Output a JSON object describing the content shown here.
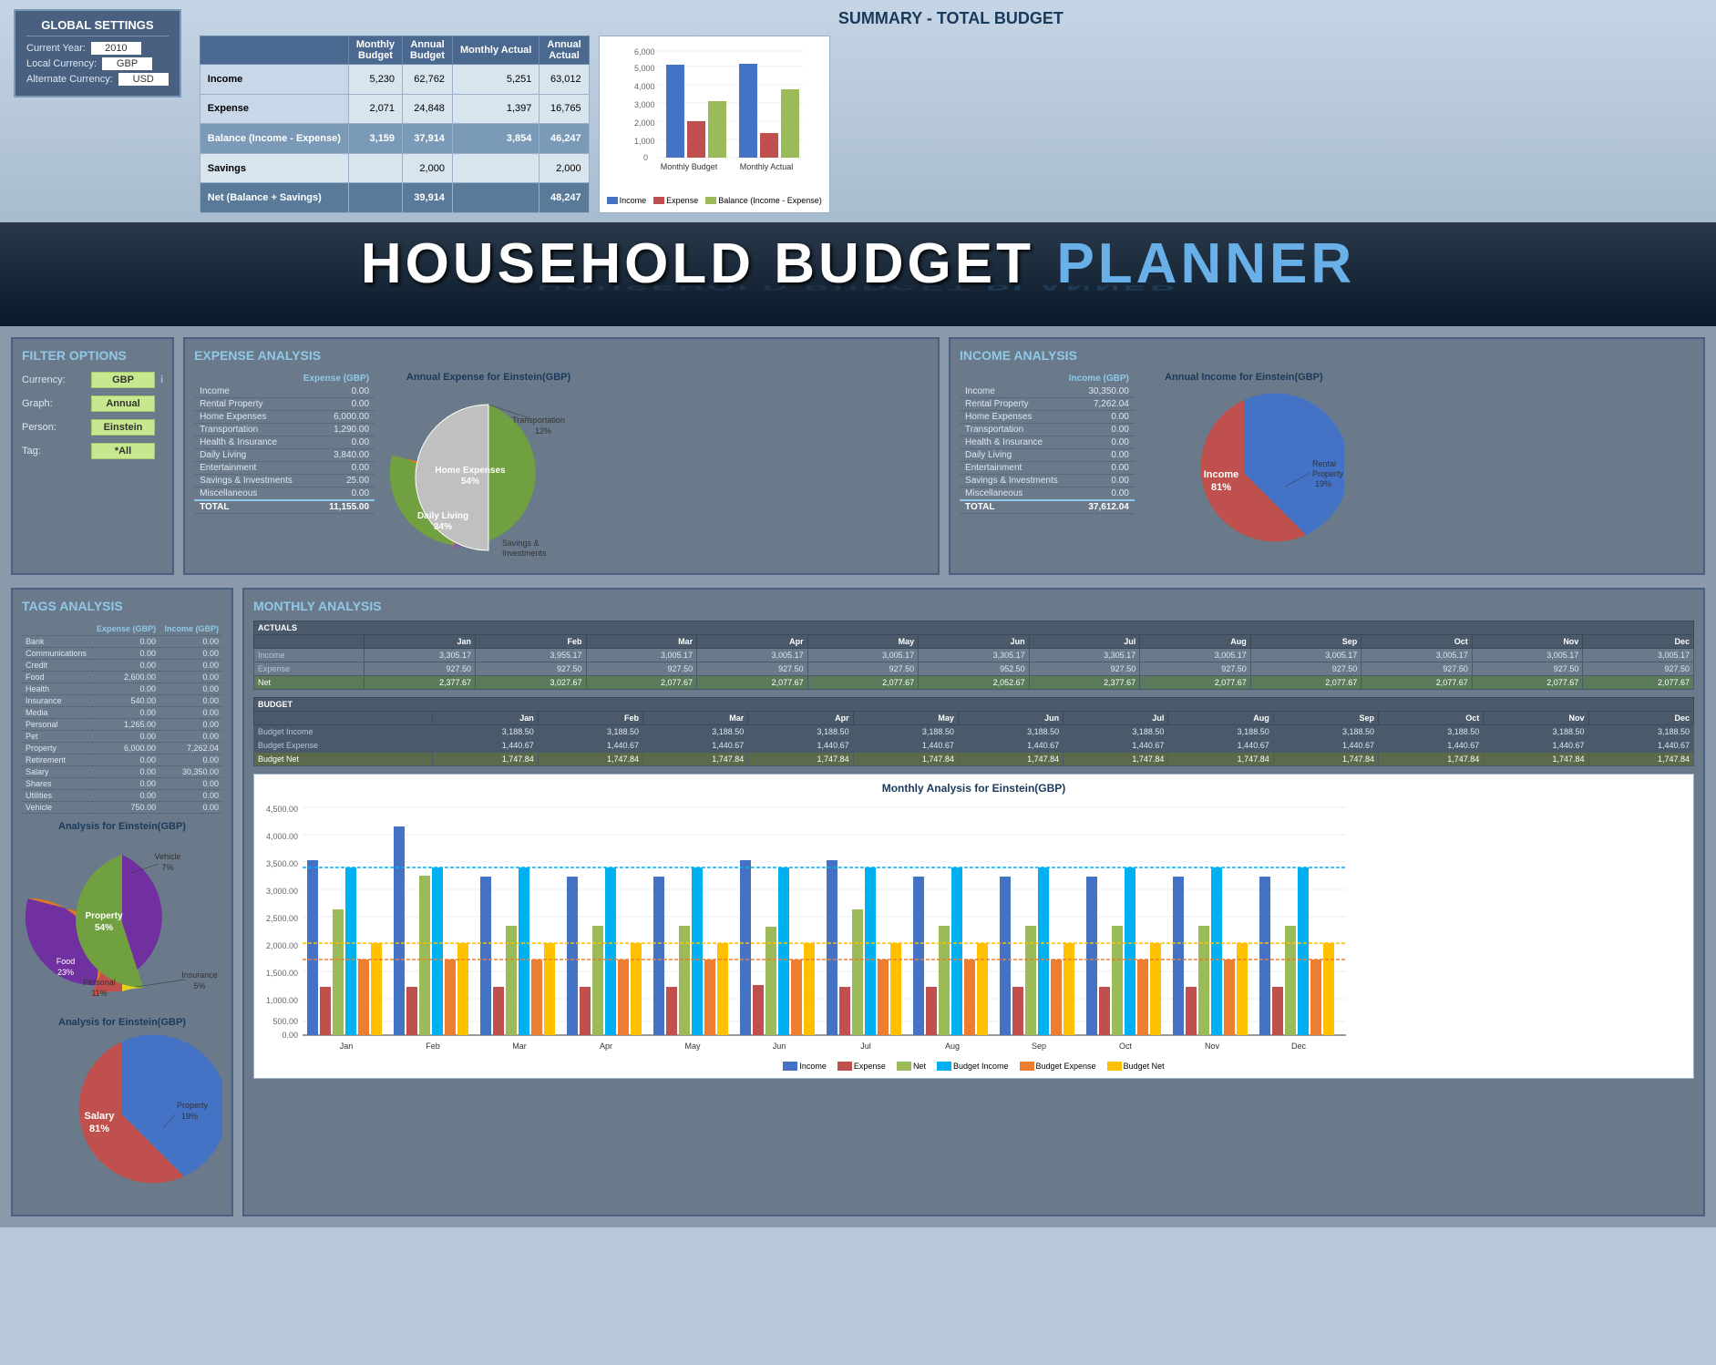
{
  "globalSettings": {
    "title": "GLOBAL SETTINGS",
    "currentYearLabel": "Current Year:",
    "currentYearValue": "2010",
    "localCurrencyLabel": "Local Currency:",
    "localCurrencyValue": "GBP",
    "alternateCurrencyLabel": "Alternate Currency:",
    "alternateCurrencyValue": "USD"
  },
  "summary": {
    "title": "SUMMARY - TOTAL BUDGET",
    "headers": [
      "",
      "Monthly Budget",
      "Annual Budget",
      "Monthly Actual",
      "Annual Actual"
    ],
    "rows": [
      {
        "label": "Income",
        "monthlyBudget": "5,230",
        "annualBudget": "62,762",
        "monthlyActual": "5,251",
        "annualActual": "63,012"
      },
      {
        "label": "Expense",
        "monthlyBudget": "2,071",
        "annualBudget": "24,848",
        "monthlyActual": "1,397",
        "annualActual": "16,765"
      }
    ],
    "balance": {
      "label": "Balance (Income - Expense)",
      "monthlyBudget": "3,159",
      "annualBudget": "37,914",
      "monthlyActual": "3,854",
      "annualActual": "46,247"
    },
    "savings": {
      "label": "Savings",
      "annualBudget": "2,000",
      "annualActual": "2,000"
    },
    "net": {
      "label": "Net (Balance + Savings)",
      "annualBudget": "39,914",
      "annualActual": "48,247"
    },
    "chartTitle": "",
    "chartLabels": [
      "Monthly Budget",
      "Monthly Actual"
    ],
    "chartData": {
      "income": [
        5230,
        5251
      ],
      "expense": [
        2071,
        1397
      ],
      "balance": [
        3159,
        3854
      ]
    },
    "chartYLabels": [
      "6,000",
      "5,000",
      "4,000",
      "3,000",
      "2,000",
      "1,000",
      "0"
    ],
    "chartLegend": [
      "Income",
      "Expense",
      "Balance (Income - Expense)"
    ],
    "chartColors": {
      "income": "#4472c4",
      "expense": "#c0504d",
      "balance": "#9bbb59"
    }
  },
  "titleBanner": {
    "main": "HOUSEHOLD BUDGET",
    "planner": "PLANNER"
  },
  "filterOptions": {
    "title": "FILTER OPTIONS",
    "currency": {
      "label": "Currency:",
      "value": "GBP"
    },
    "graph": {
      "label": "Graph:",
      "value": "Annual"
    },
    "person": {
      "label": "Person:",
      "value": "Einstein"
    },
    "tag": {
      "label": "Tag:",
      "value": "*All"
    }
  },
  "expenseAnalysis": {
    "title": "EXPENSE ANALYSIS",
    "chartTitle": "Annual Expense for Einstein(GBP)",
    "tableHeader": "Expense (GBP)",
    "rows": [
      {
        "label": "Income",
        "value": "0.00"
      },
      {
        "label": "Rental Property",
        "value": "0.00"
      },
      {
        "label": "Home Expenses",
        "value": "6,000.00"
      },
      {
        "label": "Transportation",
        "value": "1,290.00"
      },
      {
        "label": "Health & Insurance",
        "value": "0.00"
      },
      {
        "label": "Daily Living",
        "value": "3,840.00"
      },
      {
        "label": "Entertainment",
        "value": "0.00"
      },
      {
        "label": "Savings & Investments",
        "value": "25.00"
      },
      {
        "label": "Miscellaneous",
        "value": "0.00"
      },
      {
        "label": "TOTAL",
        "value": "11,155.00"
      }
    ],
    "pieSlices": [
      {
        "label": "Home Expenses",
        "pct": 54,
        "color": "#70a040"
      },
      {
        "label": "Daily Living",
        "pct": 34,
        "color": "#e07820"
      },
      {
        "label": "Transportation",
        "pct": 12,
        "color": "#8060a0"
      },
      {
        "label": "Savings & Investments",
        "pct": 0,
        "color": "#808080"
      }
    ]
  },
  "incomeAnalysis": {
    "title": "INCOME ANALYSIS",
    "chartTitle": "Annual Income for Einstein(GBP)",
    "tableHeader": "Income (GBP)",
    "rows": [
      {
        "label": "Income",
        "value": "30,350.00"
      },
      {
        "label": "Rental Property",
        "value": "7,262.04"
      },
      {
        "label": "Home Expenses",
        "value": "0.00"
      },
      {
        "label": "Transportation",
        "value": "0.00"
      },
      {
        "label": "Health & Insurance",
        "value": "0.00"
      },
      {
        "label": "Daily Living",
        "value": "0.00"
      },
      {
        "label": "Entertainment",
        "value": "0.00"
      },
      {
        "label": "Savings & Investments",
        "value": "0.00"
      },
      {
        "label": "Miscellaneous",
        "value": "0.00"
      },
      {
        "label": "TOTAL",
        "value": "37,612.04"
      }
    ],
    "pieSlices": [
      {
        "label": "Income",
        "pct": 81,
        "color": "#4472c4"
      },
      {
        "label": "Rental Property",
        "pct": 19,
        "color": "#c0504d"
      }
    ]
  },
  "tagsAnalysis": {
    "title": "TAGS ANALYSIS",
    "headers": [
      "",
      "Expense (GBP)",
      "Income (GBP)"
    ],
    "rows": [
      {
        "label": "Bank",
        "expense": "0.00",
        "income": "0.00"
      },
      {
        "label": "Communications",
        "expense": "0.00",
        "income": "0.00"
      },
      {
        "label": "Credit",
        "expense": "0.00",
        "income": "0.00"
      },
      {
        "label": "Food",
        "expense": "2,600.00",
        "income": "0.00"
      },
      {
        "label": "Health",
        "expense": "0.00",
        "income": "0.00"
      },
      {
        "label": "Insurance",
        "expense": "540.00",
        "income": "0.00"
      },
      {
        "label": "Media",
        "expense": "0.00",
        "income": "0.00"
      },
      {
        "label": "Personal",
        "expense": "1,265.00",
        "income": "0.00"
      },
      {
        "label": "Pet",
        "expense": "0.00",
        "income": "0.00"
      },
      {
        "label": "Property",
        "expense": "6,000.00",
        "income": "7,262.04"
      },
      {
        "label": "Retirement",
        "expense": "0.00",
        "income": "0.00"
      },
      {
        "label": "Salary",
        "expense": "0.00",
        "income": "30,350.00"
      },
      {
        "label": "Shares",
        "expense": "0.00",
        "income": "0.00"
      },
      {
        "label": "Utilities",
        "expense": "0.00",
        "income": "0.00"
      },
      {
        "label": "Vehicle",
        "expense": "750.00",
        "income": "0.00"
      }
    ],
    "pie1Title": "Analysis for Einstein(GBP)",
    "pie1Slices": [
      {
        "label": "Property",
        "pct": 54,
        "color": "#7030a0"
      },
      {
        "label": "Food",
        "pct": 23,
        "color": "#e07820"
      },
      {
        "label": "Personal",
        "pct": 11,
        "color": "#c0504d"
      },
      {
        "label": "Insurance",
        "pct": 5,
        "color": "#e8d020"
      },
      {
        "label": "Vehicle",
        "pct": 7,
        "color": "#70a040"
      }
    ],
    "pie2Title": "Analysis for Einstein(GBP)",
    "pie2Slices": [
      {
        "label": "Salary",
        "pct": 81,
        "color": "#4472c4"
      },
      {
        "label": "Property",
        "pct": 19,
        "color": "#c0504d"
      }
    ]
  },
  "monthlyAnalysis": {
    "title": "MONTHLY ANALYSIS",
    "actualsLabel": "ACTUALS",
    "budgetLabel": "BUDGET",
    "months": [
      "Jan",
      "Feb",
      "Mar",
      "Apr",
      "May",
      "Jun",
      "Jul",
      "Aug",
      "Sep",
      "Oct",
      "Nov",
      "Dec"
    ],
    "actuals": {
      "income": [
        "3,305.17",
        "3,955.17",
        "3,005.17",
        "3,005.17",
        "3,005.17",
        "3,305.17",
        "3,305.17",
        "3,005.17",
        "3,005.17",
        "3,005.17",
        "3,005.17",
        "3,005.17"
      ],
      "expense": [
        "927.50",
        "927.50",
        "927.50",
        "927.50",
        "927.50",
        "952.50",
        "927.50",
        "927.50",
        "927.50",
        "927.50",
        "927.50",
        "927.50"
      ],
      "net": [
        "2,377.67",
        "3,027.67",
        "2,077.67",
        "2,077.67",
        "2,077.67",
        "2,052.67",
        "2,377.67",
        "2,077.67",
        "2,077.67",
        "2,077.67",
        "2,077.67",
        "2,077.67"
      ]
    },
    "budget": {
      "income": [
        "3,188.50",
        "3,188.50",
        "3,188.50",
        "3,188.50",
        "3,188.50",
        "3,188.50",
        "3,188.50",
        "3,188.50",
        "3,188.50",
        "3,188.50",
        "3,188.50",
        "3,188.50"
      ],
      "expense": [
        "1,440.67",
        "1,440.67",
        "1,440.67",
        "1,440.67",
        "1,440.67",
        "1,440.67",
        "1,440.67",
        "1,440.67",
        "1,440.67",
        "1,440.67",
        "1,440.67",
        "1,440.67"
      ],
      "net": [
        "1,747.84",
        "1,747.84",
        "1,747.84",
        "1,747.84",
        "1,747.84",
        "1,747.84",
        "1,747.84",
        "1,747.84",
        "1,747.84",
        "1,747.84",
        "1,747.84",
        "1,747.84"
      ]
    },
    "chartTitle": "Monthly Analysis for Einstein(GBP)",
    "chartLegend": [
      "Income",
      "Expense",
      "Net",
      "Budget Income",
      "Budget Expense",
      "Budget Net"
    ],
    "chartColors": {
      "income": "#4472c4",
      "expense": "#c0504d",
      "net": "#9bbb59",
      "budgetIncome": "#00b0f0",
      "budgetExpense": "#ed7d31",
      "budgetNet": "#ffc000"
    }
  }
}
